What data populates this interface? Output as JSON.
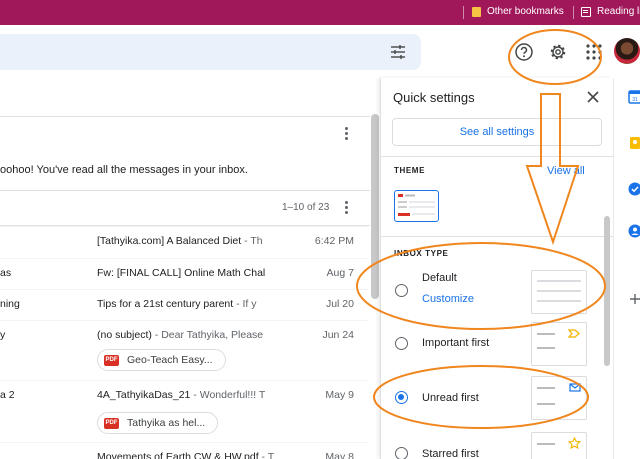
{
  "bookmarks_bar": {
    "items": [
      {
        "label": "Other bookmarks",
        "icon": "folder-icon"
      },
      {
        "label": "Reading lis",
        "icon": "reading-list-icon"
      }
    ]
  },
  "header": {
    "icons": [
      "search-options-icon",
      "help-icon",
      "settings-icon",
      "apps-icon",
      "avatar"
    ]
  },
  "mail": {
    "empty_message": "oohoo! You've read all the messages in your inbox.",
    "pager": "1–10 of 23",
    "rows": [
      {
        "sender": "",
        "subject": "[Tathyika.com] A Balanced Diet",
        "snippet": " - Th",
        "date": "6:42 PM"
      },
      {
        "sender": "as",
        "subject": "Fw: [FINAL CALL] Online Math Chal",
        "snippet": "",
        "date": "Aug 7"
      },
      {
        "sender": "ning",
        "subject": "Tips for a 21st century parent",
        "snippet": " - If y",
        "date": "Jul 20"
      },
      {
        "sender": "y",
        "subject": "(no subject)",
        "snippet": " - Dear Tathyika, Please",
        "date": "Jun 24",
        "attachment": "Geo-Teach Easy..."
      },
      {
        "sender": "a 2",
        "subject": "4A_TathyikaDas_21",
        "snippet": " - Wonderful!!! T",
        "date": "May 9",
        "attachment": "Tathyika as hel..."
      },
      {
        "sender": "",
        "subject": "Movements of Earth CW & HW.pdf",
        "snippet": " - T",
        "date": "May 8"
      }
    ]
  },
  "quick_settings": {
    "title": "Quick settings",
    "see_all": "See all settings",
    "theme_label": "THEME",
    "view_all": "View all",
    "inbox_type_label": "INBOX TYPE",
    "options": [
      {
        "label": "Default",
        "selected": false,
        "link": "Customize"
      },
      {
        "label": "Important first",
        "selected": false
      },
      {
        "label": "Unread first",
        "selected": true
      },
      {
        "label": "Starred first",
        "selected": false
      }
    ]
  },
  "side_rail": {
    "icons": [
      "calendar-icon",
      "keep-icon",
      "tasks-icon",
      "contacts-icon",
      "add-icon"
    ]
  },
  "colors": {
    "bookmark_bar": "#a0185a",
    "accent": "#1a73e8",
    "annotation": "#f0861e",
    "search_bg": "#eaf1fb"
  }
}
